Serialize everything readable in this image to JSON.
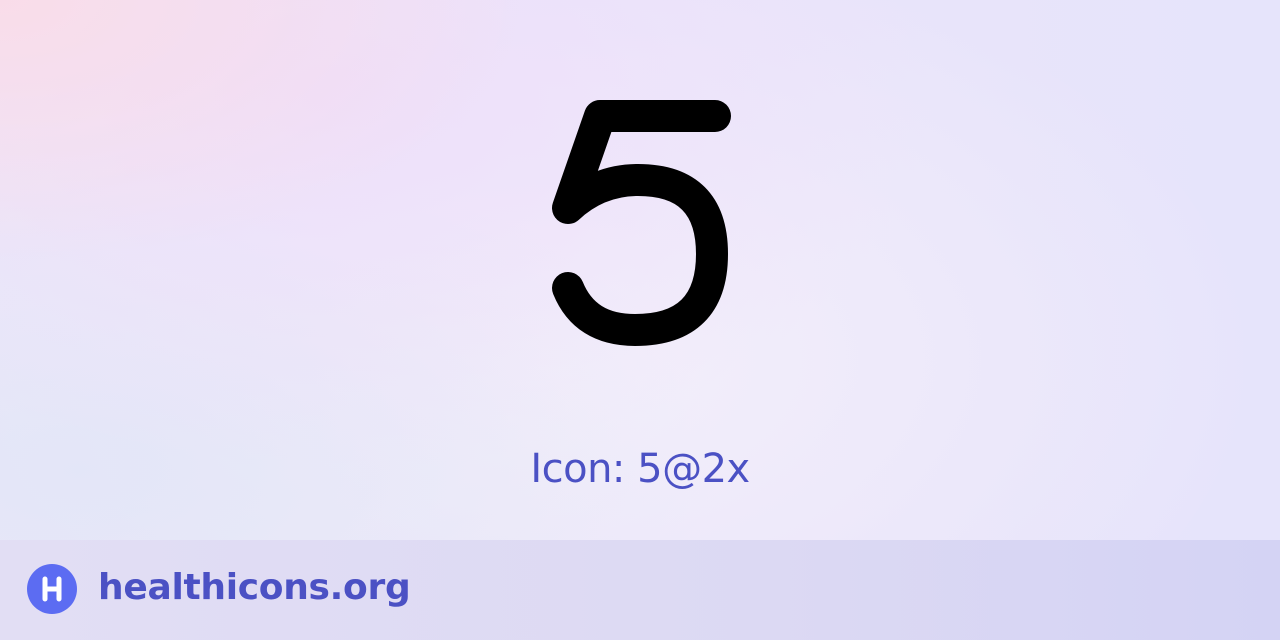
{
  "icon": {
    "name": "five-icon",
    "color": "#000000"
  },
  "caption": "Icon: 5@2x",
  "footer": {
    "logo_icon": "healthicons-logo-icon",
    "site": "healthicons.org",
    "logo_color": "#5c6cf2",
    "text_color": "#4b51c4"
  }
}
